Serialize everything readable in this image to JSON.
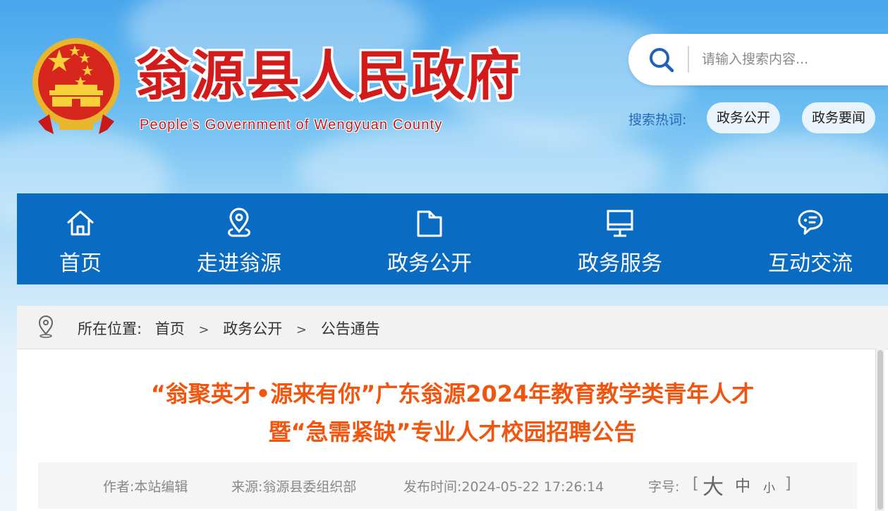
{
  "header": {
    "title": "翁源县人民政府",
    "subtitle": "People’s Government of Wengyuan County"
  },
  "search": {
    "placeholder": "请输入搜索内容...",
    "hot_label": "搜索热词:",
    "hot_tags": [
      "政务公开",
      "政务要闻"
    ]
  },
  "nav": {
    "items": [
      {
        "label": "首页",
        "icon": "home-icon"
      },
      {
        "label": "走进翁源",
        "icon": "location-pin-icon"
      },
      {
        "label": "政务公开",
        "icon": "folder-icon"
      },
      {
        "label": "政务服务",
        "icon": "monitor-icon"
      },
      {
        "label": "互动交流",
        "icon": "chat-bubble-icon"
      }
    ]
  },
  "breadcrumb": {
    "prefix": "所在位置:",
    "items": [
      "首页",
      "政务公开",
      "公告通告"
    ],
    "separator": ">"
  },
  "article": {
    "title_line1": "“翁聚英才•源来有你”广东翁源2024年教育教学类青年人才",
    "title_line2": "暨“急需紧缺”专业人才校园招聘公告",
    "author": "作者:本站编辑",
    "source": "来源:翁源县委组织部",
    "published": "发布时间:2024-05-22 17:26:14",
    "font_size_label": "字号:",
    "font_size_open": "[",
    "font_size_options": [
      "大",
      "中",
      "小"
    ],
    "font_size_close": "]"
  },
  "colors": {
    "nav_bg": "#0a6bc2",
    "title_red": "#d31b1b",
    "article_title": "#f0560f",
    "hot_label": "#2769b6"
  }
}
